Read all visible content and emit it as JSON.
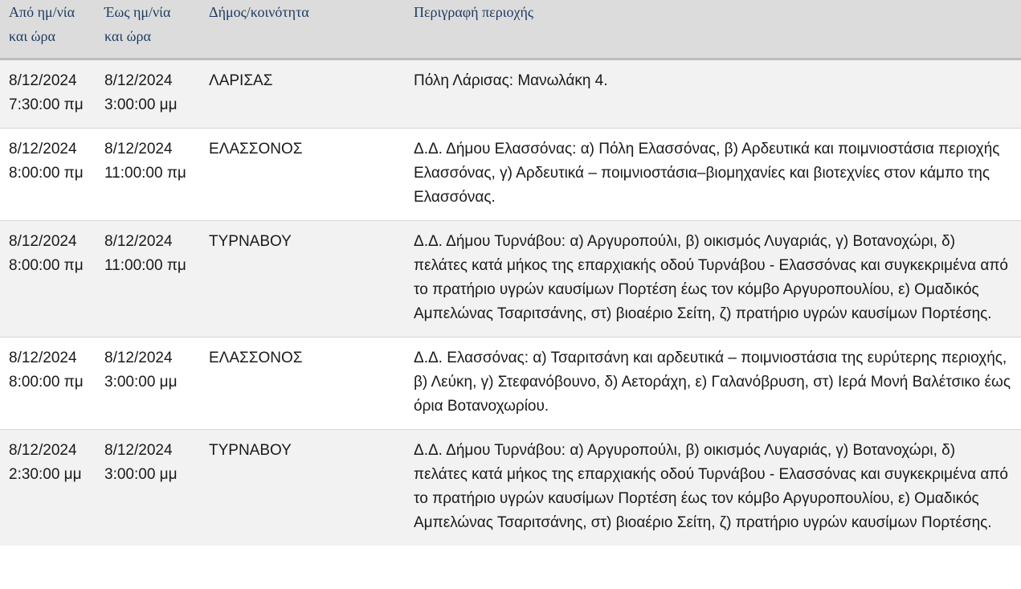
{
  "table": {
    "headers": {
      "from": [
        "Από ημ/νία",
        "και ώρα"
      ],
      "to": [
        "Έως ημ/νία",
        "και ώρα"
      ],
      "municipality": "Δήμος/κοινότητα",
      "area": "Περιγραφή περιοχής"
    },
    "rows": [
      {
        "from_date": "8/12/2024",
        "from_time": "7:30:00 πμ",
        "to_date": "8/12/2024",
        "to_time": "3:00:00 μμ",
        "municipality": "ΛΑΡΙΣΑΣ",
        "area": "Πόλη Λάρισας: Μανωλάκη 4."
      },
      {
        "from_date": "8/12/2024",
        "from_time": "8:00:00 πμ",
        "to_date": "8/12/2024",
        "to_time": "11:00:00 πμ",
        "municipality": "ΕΛΑΣΣΟΝΟΣ",
        "area": "Δ.Δ. Δήμου Ελασσόνας: α) Πόλη Ελασσόνας, β) Αρδευτικά και ποιμνιοστάσια περιοχής Ελασσόνας, γ) Αρδευτικά – ποιμνιοστάσια–βιομηχανίες και βιοτεχνίες στον κάμπο της Ελασσόνας."
      },
      {
        "from_date": "8/12/2024",
        "from_time": "8:00:00 πμ",
        "to_date": "8/12/2024",
        "to_time": "11:00:00 πμ",
        "municipality": "ΤΥΡΝΑΒΟΥ",
        "area": "Δ.Δ. Δήμου Τυρνάβου: α) Αργυροπούλι, β) οικισμός Λυγαριάς, γ) Βοτανοχώρι, δ) πελάτες κατά μήκος της επαρχιακής οδού Τυρνάβου - Ελασσόνας και συγκεκριμένα από το πρατήριο υγρών καυσίμων Πορτέση έως τον κόμβο Αργυροπουλίου, ε) Ομαδικός Αμπελώνας Τσαριτσάνης, στ) βιοαέριο Σείτη, ζ) πρατήριο υγρών καυσίμων Πορτέσης."
      },
      {
        "from_date": "8/12/2024",
        "from_time": "8:00:00 πμ",
        "to_date": "8/12/2024",
        "to_time": "3:00:00 μμ",
        "municipality": "ΕΛΑΣΣΟΝΟΣ",
        "area": "Δ.Δ. Ελασσόνας: α) Τσαριτσάνη και αρδευτικά – ποιμνιοστάσια της ευρύτερης περιοχής, β) Λεύκη, γ) Στεφανόβουνο, δ) Αετοράχη, ε) Γαλανόβρυση, στ) Ιερά Μονή Βαλέτσικο έως όρια Βοτανοχωρίου."
      },
      {
        "from_date": "8/12/2024",
        "from_time": "2:30:00 μμ",
        "to_date": "8/12/2024",
        "to_time": "3:00:00 μμ",
        "municipality": "ΤΥΡΝΑΒΟΥ",
        "area": "Δ.Δ. Δήμου Τυρνάβου: α) Αργυροπούλι, β) οικισμός Λυγαριάς, γ) Βοτανοχώρι, δ) πελάτες κατά μήκος της επαρχιακής οδού Τυρνάβου - Ελασσόνας και συγκεκριμένα από το πρατήριο υγρών καυσίμων Πορτέση έως τον κόμβο Αργυροπουλίου, ε) Ομαδικός Αμπελώνας Τσαριτσάνης, στ) βιοαέριο Σείτη, ζ) πρατήριο υγρών καυσίμων Πορτέσης."
      }
    ]
  }
}
